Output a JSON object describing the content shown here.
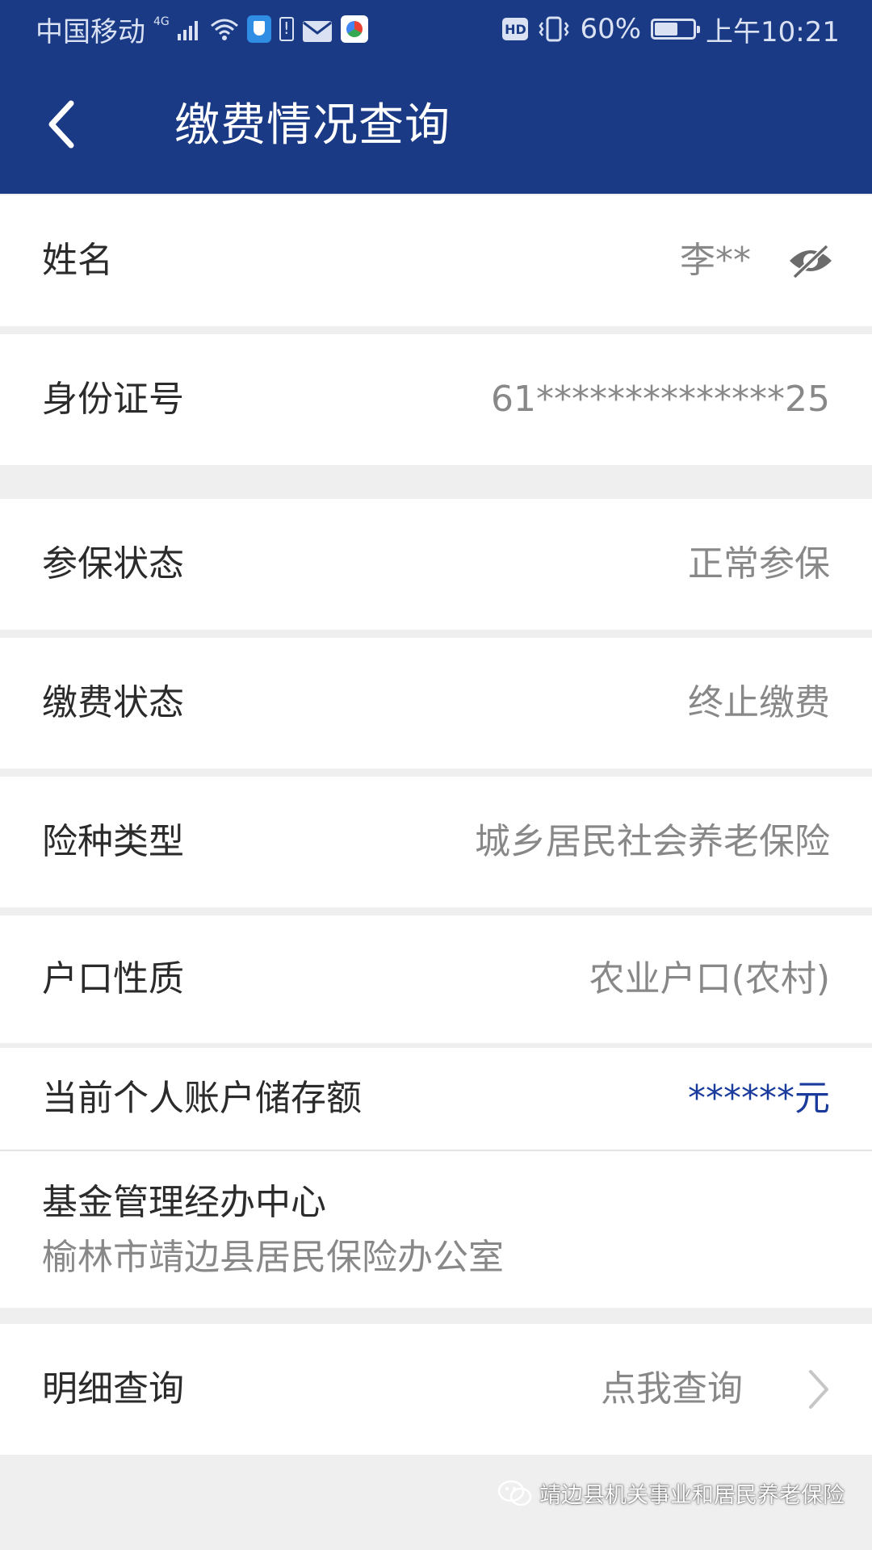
{
  "status_bar": {
    "carrier": "中国移动",
    "network_type": "4G",
    "battery_percent": "60%",
    "battery_level": 0.6,
    "hd_label": "HD",
    "time": "上午10:21",
    "icons": [
      "signal-icon",
      "wifi-icon",
      "shield-icon",
      "battery-alert-icon",
      "mail-icon",
      "app-icon",
      "hd-badge",
      "vibrate-icon",
      "battery-icon"
    ]
  },
  "header": {
    "title": "缴费情况查询",
    "background_color": "#1a3a86",
    "back_icon": "back-arrow-icon"
  },
  "fields": {
    "name": {
      "label": "姓名",
      "value": "李**",
      "icon": "eye-off-icon"
    },
    "id_number": {
      "label": "身份证号",
      "value": "61**************25"
    },
    "insurance_status": {
      "label": "参保状态",
      "value": "正常参保"
    },
    "payment_status": {
      "label": "缴费状态",
      "value": "终止缴费"
    },
    "insurance_type": {
      "label": "险种类型",
      "value": "城乡居民社会养老保险"
    },
    "household_type": {
      "label": "户口性质",
      "value": "农业户口(农村)"
    },
    "account_balance": {
      "label": "当前个人账户储存额",
      "value": "******元",
      "value_color": "#1a3a9c"
    },
    "fund_center": {
      "label": "基金管理经办中心",
      "value": "榆林市靖边县居民保险办公室"
    }
  },
  "detail_query": {
    "label": "明细查询",
    "action": "点我查询",
    "icon": "chevron-right-icon"
  },
  "watermark": {
    "text": "靖边县机关事业和居民养老保险",
    "icon": "wechat-icon"
  },
  "colors": {
    "primary": "#1a3a86",
    "page_background": "#efefef",
    "label_text": "#2b2b2b",
    "value_text": "#888888"
  }
}
